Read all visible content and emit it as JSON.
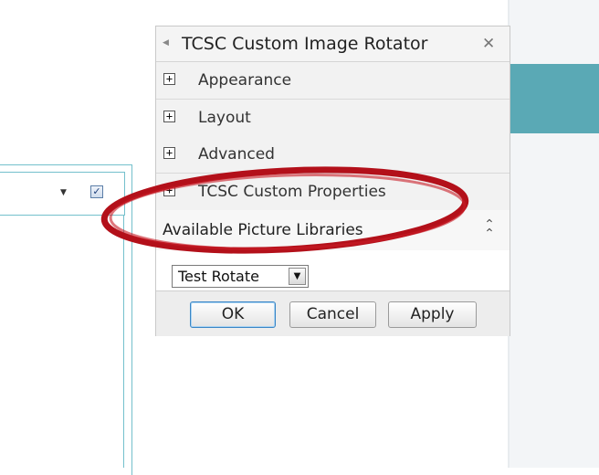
{
  "pane": {
    "title": "TCSC Custom Image Rotator",
    "sections": [
      {
        "label": "Appearance"
      },
      {
        "label": "Layout"
      },
      {
        "label": "Advanced"
      },
      {
        "label": "TCSC Custom Properties"
      }
    ],
    "libraries": {
      "label": "Available Picture Libraries",
      "selected": "Test Rotate"
    },
    "buttons": {
      "ok": "OK",
      "cancel": "Cancel",
      "apply": "Apply"
    },
    "icons": {
      "back": "back-arrow-icon",
      "close": "close-icon",
      "expand": "plus-icon",
      "collapse": "collapse-chevron-icon"
    }
  },
  "webpart": {
    "checkbox_checked": true
  },
  "colors": {
    "accent_teal": "#5aa9b5",
    "highlight_red": "#b3101a",
    "ok_border": "#3a86c6"
  }
}
